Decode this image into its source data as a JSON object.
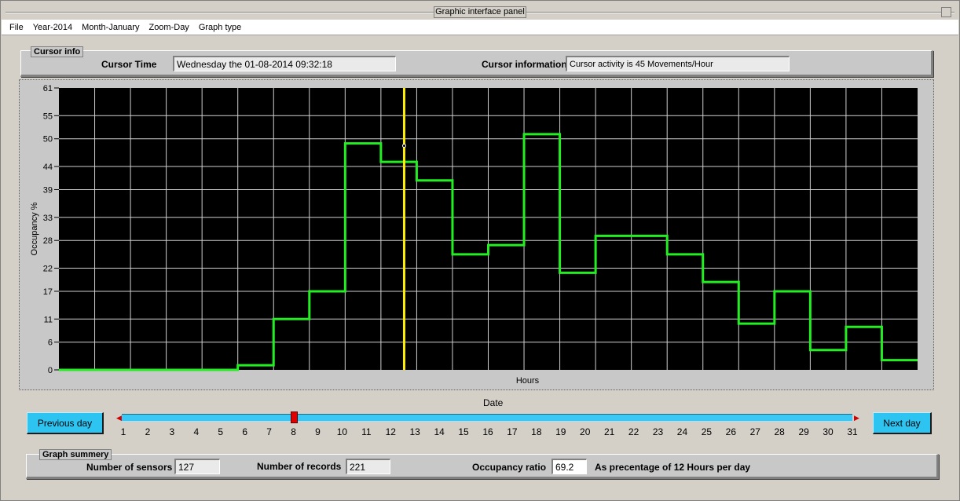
{
  "window": {
    "title": "Graphic interface panel"
  },
  "menu": [
    "File",
    "Year-2014",
    "Month-January",
    "Zoom-Day",
    "Graph type"
  ],
  "cursor_info": {
    "tag": "Cursor info",
    "time_label": "Cursor Time",
    "time_value": "Wednesday the 01-08-2014 09:32:18",
    "info_label": "Cursor information",
    "info_value": "Cursor activity is 45 Movements/Hour"
  },
  "chart_data": {
    "type": "line",
    "step": true,
    "ylabel": "Occupancy %",
    "xlabel": "Hours",
    "ylim": [
      0,
      61
    ],
    "yticks": [
      0,
      6,
      11,
      17,
      22,
      28,
      33,
      39,
      44,
      50,
      55,
      61
    ],
    "x_bins": 24,
    "grid": true,
    "background": "#000000",
    "line_color": "#22ee22",
    "values": [
      0,
      0,
      0,
      0,
      0,
      1,
      11,
      17,
      49,
      45,
      41,
      25,
      27,
      51,
      21,
      29,
      29,
      25,
      19,
      10,
      17,
      4.3,
      9.3,
      2.1
    ],
    "cursor": {
      "x": 9.65,
      "y": 48.5,
      "color": "#ffee00"
    }
  },
  "date_axis": {
    "label": "Date",
    "days": [
      "1",
      "2",
      "3",
      "4",
      "5",
      "6",
      "7",
      "8",
      "9",
      "10",
      "11",
      "12",
      "13",
      "14",
      "15",
      "16",
      "17",
      "18",
      "19",
      "20",
      "21",
      "22",
      "23",
      "24",
      "25",
      "26",
      "27",
      "28",
      "29",
      "30",
      "31"
    ],
    "selected_day": 8
  },
  "buttons": {
    "prev": "Previous day",
    "next": "Next  day"
  },
  "summary": {
    "tag": "Graph summery",
    "sensors_label": "Number of sensors",
    "sensors_value": "127",
    "records_label": "Number of records",
    "records_value": "221",
    "ratio_label": "Occupancy ratio",
    "ratio_value": "69.2",
    "ratio_note": "As precentage of 12 Hours per day"
  }
}
